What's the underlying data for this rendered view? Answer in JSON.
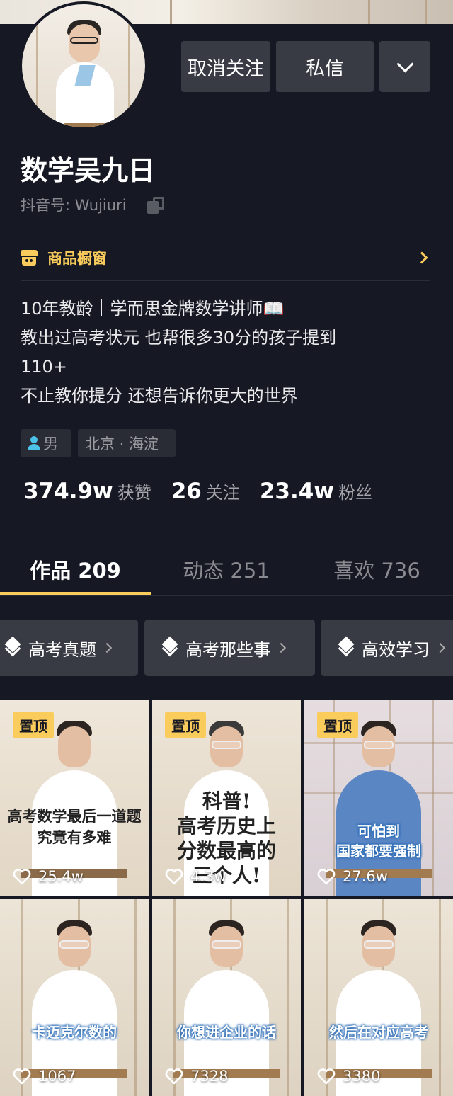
{
  "profile": {
    "name": "数学吴九日",
    "douyin_id": "抖音号: Wujiuri",
    "actions": {
      "unfollow": "取消关注",
      "message": "私信"
    },
    "shop": {
      "label": "商品橱窗"
    },
    "bio": [
      "10年教龄｜学而思金牌数学讲师📖",
      "教出过高考状元 也帮很多30分的孩子提到",
      "110+",
      "不止教你提分 还想告诉你更大的世界"
    ],
    "tags": {
      "gender": "男",
      "location": "北京 · 海淀"
    },
    "stats": [
      {
        "value": "374.9w",
        "label": "获赞"
      },
      {
        "value": "26",
        "label": "关注"
      },
      {
        "value": "23.4w",
        "label": "粉丝"
      }
    ]
  },
  "tabs": [
    {
      "label": "作品 209",
      "active": true
    },
    {
      "label": "动态 251",
      "active": false
    },
    {
      "label": "喜欢 736",
      "active": false
    }
  ],
  "collections": [
    {
      "label": "高考真题"
    },
    {
      "label": "高考那些事"
    },
    {
      "label": "高效学习"
    }
  ],
  "videos": [
    {
      "pinned": true,
      "pin_label": "置顶",
      "caption_lines": [
        "高考数学最后一道题",
        "究竟有多难"
      ],
      "likes": "25.4w",
      "style": "serif"
    },
    {
      "pinned": true,
      "pin_label": "置顶",
      "caption_lines": [
        "科普!",
        "高考历史上",
        "分数最高的",
        "三个人!"
      ],
      "likes": "4.3w",
      "style": "serif-big"
    },
    {
      "pinned": true,
      "pin_label": "置顶",
      "caption_lines": [
        "可怕到",
        "国家都要强制"
      ],
      "likes": "27.6w",
      "style": "blue"
    },
    {
      "pinned": false,
      "caption_lines": [
        "卡迈克尔数的"
      ],
      "likes": "1067",
      "style": "blue"
    },
    {
      "pinned": false,
      "caption_lines": [
        "你想进企业的话"
      ],
      "likes": "7328",
      "style": "blue"
    },
    {
      "pinned": false,
      "caption_lines": [
        "然后在对应高考"
      ],
      "likes": "3380",
      "style": "blue"
    }
  ],
  "colors": {
    "background": "#161823",
    "accent": "#facc5c",
    "button": "#393b44"
  },
  "icons": [
    "copy-icon",
    "shop-icon",
    "chevron-right-icon",
    "chevron-down-icon",
    "person-icon",
    "stack-icon",
    "heart-icon"
  ]
}
